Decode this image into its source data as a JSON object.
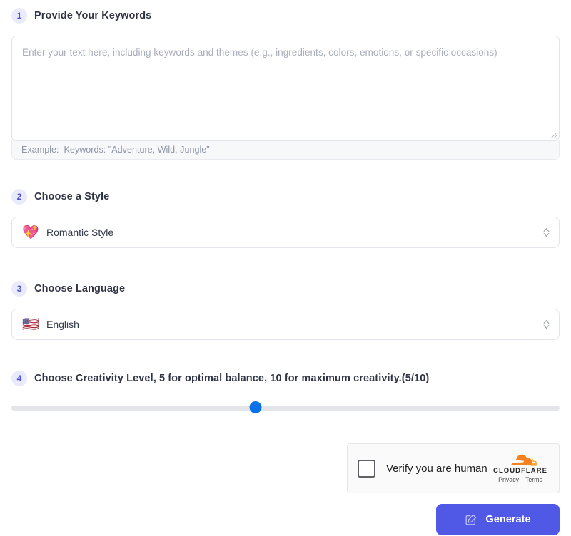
{
  "steps": {
    "keywords": {
      "number": "1",
      "title": "Provide Your Keywords",
      "placeholder": "Enter your text here, including keywords and themes (e.g., ingredients, colors, emotions, or specific occasions)",
      "value": "",
      "example_label": "Example:",
      "example_text": "Keywords: \"Adventure, Wild, Jungle\""
    },
    "style": {
      "number": "2",
      "title": "Choose a Style",
      "emoji": "💖",
      "emoji_name": "sparkling-heart-icon",
      "selected": "Romantic Style"
    },
    "language": {
      "number": "3",
      "title": "Choose Language",
      "emoji": "🇺🇸",
      "emoji_name": "us-flag-icon",
      "selected": "English"
    },
    "creativity": {
      "number": "4",
      "title": "Choose Creativity Level, 5 for optimal balance, 10 for maximum creativity.(5/10)",
      "value": 5,
      "min": 1,
      "max": 10,
      "thumb_percent": 44.5
    }
  },
  "turnstile": {
    "checkbox_checked": false,
    "label": "Verify you are human",
    "brand": "CLOUDFLARE",
    "privacy_link": "Privacy",
    "separator": "·",
    "terms_link": "Terms"
  },
  "actions": {
    "generate_label": "Generate"
  },
  "colors": {
    "accent": "#5058e6",
    "badge_bg": "#e9eafc",
    "badge_text": "#4f52d6",
    "slider_thumb": "#0a72e8",
    "slider_track": "#e4e5e9",
    "cloudflare_orange": "#f6821f"
  }
}
